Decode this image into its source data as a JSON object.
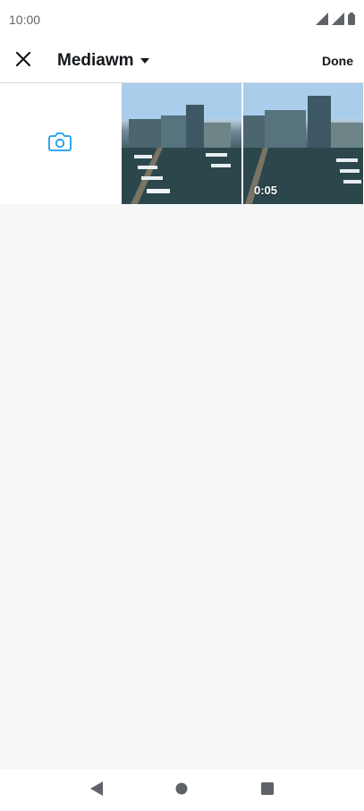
{
  "status_bar": {
    "time": "10:00",
    "icons": [
      "signal-icon",
      "signal-icon",
      "battery-icon"
    ]
  },
  "app_bar": {
    "close_icon": "close-icon",
    "title": "Mediawm",
    "dropdown_icon": "caret-down-icon",
    "done_label": "Done"
  },
  "media_grid": {
    "items": [
      {
        "type": "camera",
        "icon": "camera-icon"
      },
      {
        "type": "photo"
      },
      {
        "type": "video",
        "duration": "0:05"
      }
    ]
  },
  "nav_bar": {
    "items": [
      "back-icon",
      "home-icon",
      "recents-icon"
    ]
  },
  "colors": {
    "accent": "#1d9bf0",
    "background": "#f5f8f7",
    "text": "#14171a"
  }
}
